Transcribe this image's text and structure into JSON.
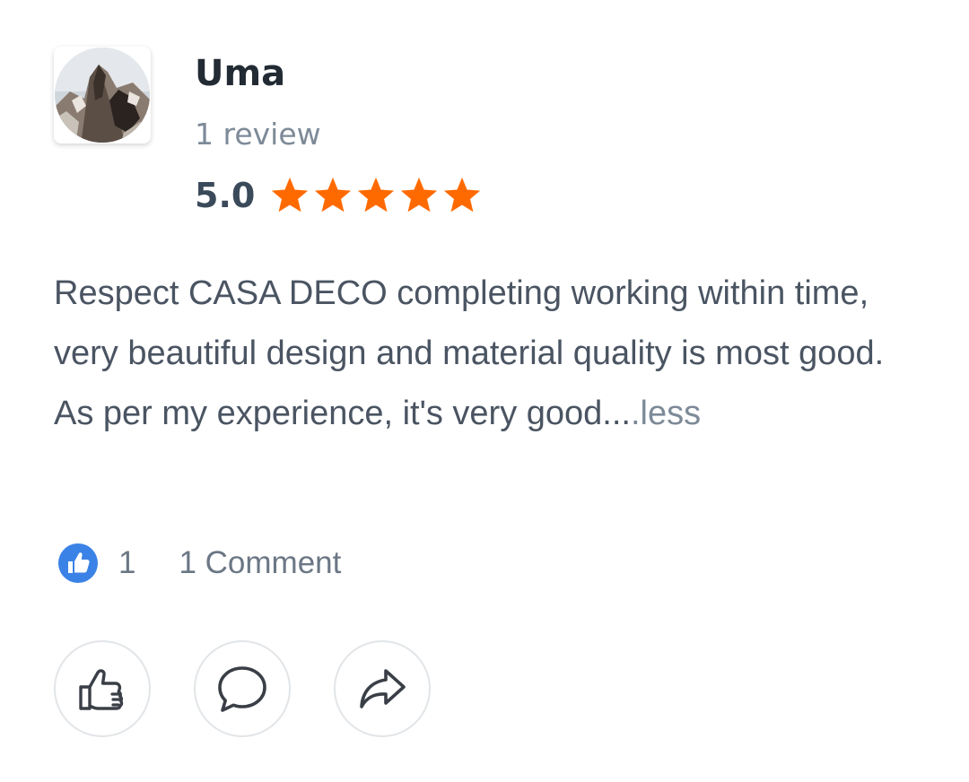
{
  "reviewer": {
    "name": "Uma",
    "review_count": "1 review",
    "avatar_icon": "mountain-photo"
  },
  "rating": {
    "value": "5.0",
    "stars": 5,
    "star_color": "#ff6a00"
  },
  "review": {
    "text": "Respect CASA DECO completing working within time, very beautiful design and material quality is most good. As per my experience, it's very good...",
    "toggle_label": ".less"
  },
  "reactions": {
    "like_count": "1",
    "comment_label": "1 Comment",
    "like_badge_color": "#3b82e6"
  },
  "actions": [
    {
      "name": "like",
      "icon": "thumbs-up-icon"
    },
    {
      "name": "comment",
      "icon": "speech-bubble-icon"
    },
    {
      "name": "share",
      "icon": "share-arrow-icon"
    }
  ]
}
